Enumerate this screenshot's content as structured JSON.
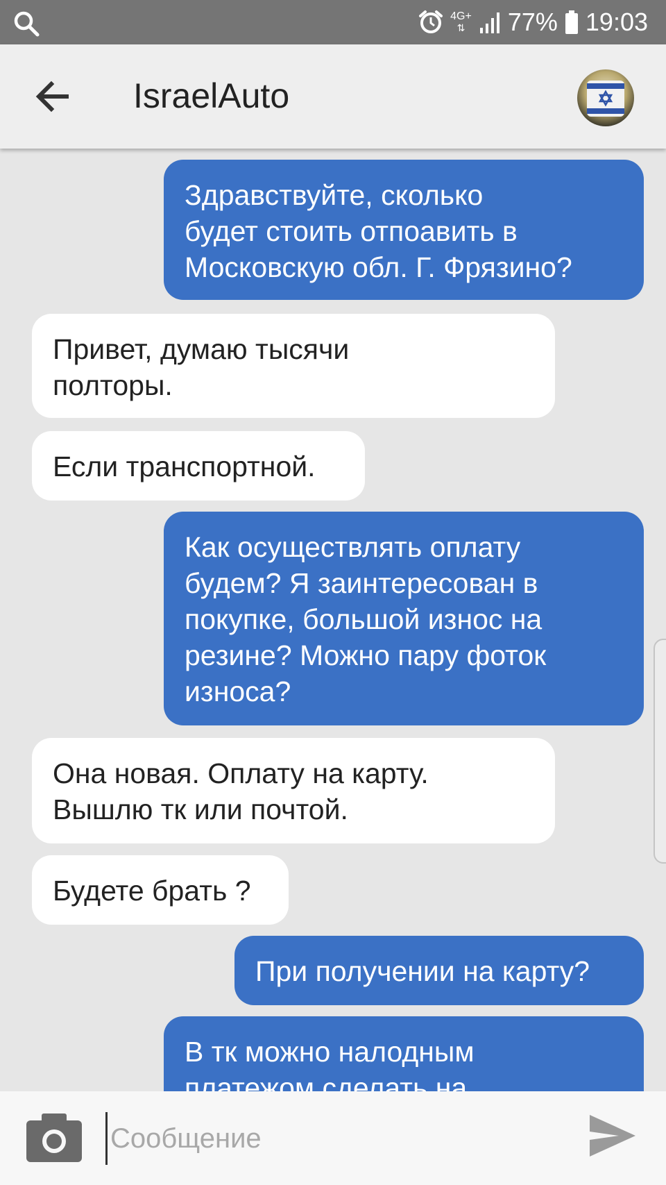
{
  "status_bar": {
    "network": "4G+",
    "battery": "77%",
    "time": "19:03",
    "icons": [
      "search-icon",
      "alarm-icon",
      "network-icon",
      "signal-icon",
      "battery-icon"
    ]
  },
  "header": {
    "title": "IsraelAuto",
    "back_icon": "arrow-left-icon",
    "avatar_icon": "star-of-david-icon"
  },
  "messages": [
    {
      "direction": "out",
      "text": "Здравствуйте, сколько\nбудет стоить отпоавить в\nМосковскую обл. Г. Фрязино?"
    },
    {
      "direction": "in",
      "text": "Привет, думаю тысячи\nполторы."
    },
    {
      "direction": "in",
      "text": "Если транспортной."
    },
    {
      "direction": "out",
      "text": "Как осуществлять оплату\nбудем? Я заинтересован в\nпокупке, большой износ на\nрезине? Можно пару фоток\nизноса?"
    },
    {
      "direction": "in",
      "text": "Она новая. Оплату на карту.\nВышлю тк или почтой."
    },
    {
      "direction": "in",
      "text": "Будете брать ?"
    },
    {
      "direction": "out",
      "text": "При получении на карту?"
    },
    {
      "direction": "out",
      "text": "В тк можно налодным\nплатежом сделать на"
    }
  ],
  "composer": {
    "placeholder": "Сообщение",
    "value": "",
    "camera_icon": "camera-icon",
    "send_icon": "send-icon"
  },
  "colors": {
    "outgoing_bubble": "#3b71c5",
    "incoming_bubble": "#ffffff",
    "chat_background": "#e6e6e6",
    "status_bar": "#757575"
  }
}
